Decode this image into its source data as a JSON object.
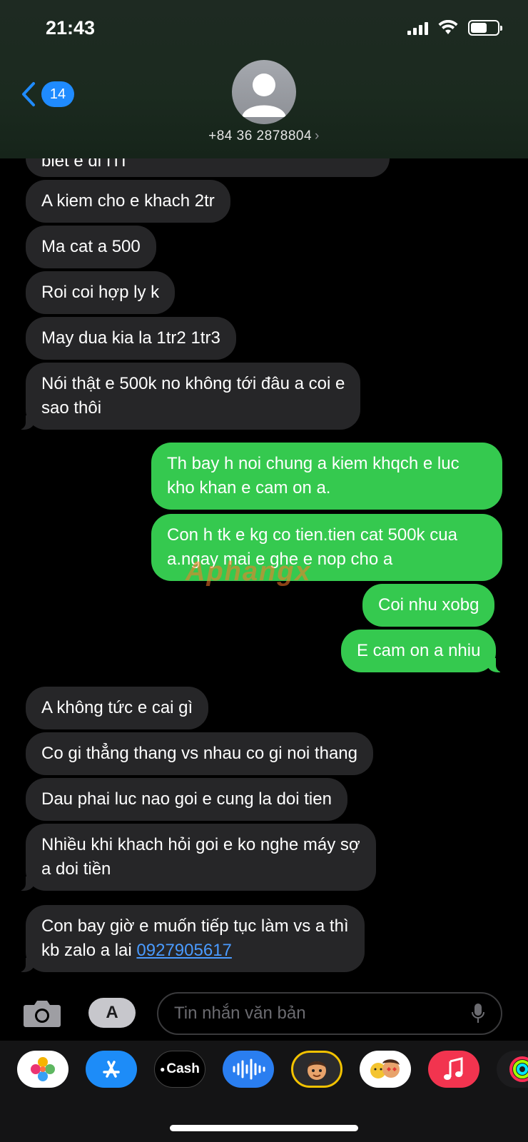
{
  "status": {
    "time": "21:43"
  },
  "header": {
    "back_count": "14",
    "contact": "+84 36 2878804",
    "chevron": "›"
  },
  "messages": [
    {
      "text": "biet e di ITI"
    },
    {
      "text": "A kiem cho e khach 2tr"
    },
    {
      "text": "Ma cat a 500"
    },
    {
      "text": "Roi coi hợp ly k"
    },
    {
      "text": "May dua kia la 1tr2 1tr3"
    },
    {
      "line1": "Nói thật e 500k no không tới đâu a coi e",
      "line2": "sao thôi"
    },
    {
      "line1": "Th bay h noi chung a kiem khqch e luc",
      "line2": "kho khan e cam on a."
    },
    {
      "line1": "Con h tk e kg co tien.tien cat 500k cua",
      "line2": "a.ngay mai e ghe e nop cho a"
    },
    {
      "text": "Coi nhu xobg"
    },
    {
      "text": "E cam on a nhiu"
    },
    {
      "text": "A không tức e cai gì"
    },
    {
      "text": "Co gi thẳng thang vs nhau co gi noi thang"
    },
    {
      "text": "Dau phai luc nao goi e cung la doi tien"
    },
    {
      "line1": "Nhiều khi khach hỏi goi e ko nghe máy sợ",
      "line2": "a doi tiền"
    },
    {
      "line1": "Con bay giờ e muốn tiếp tục làm vs a thì",
      "line2_prefix": "kb zalo a lai ",
      "link": "0927905617"
    }
  ],
  "watermark": "Aphangx",
  "input": {
    "placeholder": "Tin nhắn văn bản",
    "apps_glyph": "A"
  },
  "drawer": {
    "cash_label": "Cash"
  },
  "colors": {
    "incoming": "#262628",
    "outgoing": "#35c94f",
    "link": "#4a9bff",
    "badge": "#1f8bff"
  },
  "icons": [
    "camera-icon",
    "app-store-icon",
    "microphone-icon",
    "photos-icon",
    "apple-cash-icon",
    "audio-message-icon",
    "memoji-icon",
    "music-icon",
    "activity-icon"
  ]
}
